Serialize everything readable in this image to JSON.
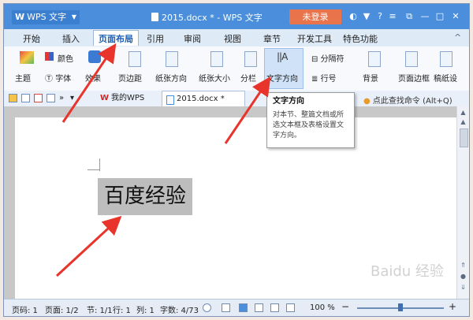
{
  "titlebar": {
    "app_label": "WPS 文字",
    "doc_title": "2015.docx * - WPS 文字",
    "login_label": "未登录"
  },
  "ribbon_tabs": [
    "开始",
    "插入",
    "页面布局",
    "引用",
    "审阅",
    "视图",
    "章节",
    "开发工具",
    "特色功能"
  ],
  "ribbon": {
    "theme": "主题",
    "color": "颜色",
    "font": "字体",
    "effect": "效果",
    "margin": "页边距",
    "orientation": "纸张方向",
    "size": "纸张大小",
    "columns": "分栏",
    "text_direction": "文字方向",
    "separator": "分隔符",
    "line_number": "行号",
    "background": "背景",
    "page_border": "页面边框",
    "manuscript": "稿纸设"
  },
  "quickbar": {
    "tab_mywps": "我的WPS",
    "tab_doc": "2015.docx *",
    "search": "点此查找命令 (Alt+Q)"
  },
  "tooltip": {
    "title": "文字方向",
    "body": "对本节、整篇文档或所选文本框及表格设置文字方向。"
  },
  "document": {
    "selected_text": "百度经验"
  },
  "statusbar": {
    "page_code": "页码: 1",
    "pages": "页面: 1/2",
    "section": "节: 1/1",
    "line": "行: 1",
    "column": "列: 1",
    "words": "字数: 4/73",
    "zoom": "100 %"
  },
  "watermark": "Baidu 经验",
  "colors": {
    "title_bar": "#4b8fdc",
    "login": "#e9734b",
    "arrow": "#e8342a"
  }
}
